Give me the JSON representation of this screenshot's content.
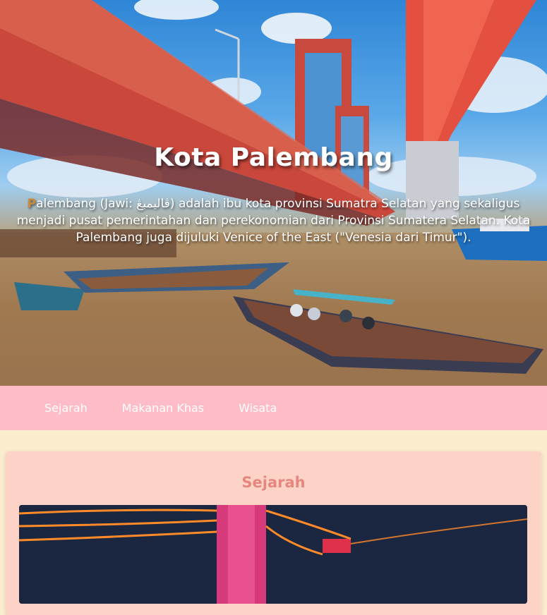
{
  "hero": {
    "title": "Kota Palembang",
    "description_first_letter": "P",
    "description_rest": "alembang (Jawi: ڤاليمبڠ) adalah ibu kota provinsi Sumatra Selatan yang sekaligus menjadi pusat pemerintahan dan perekonomian dari Provinsi Sumatera Selatan. Kota Palembang juga dijuluki Venice of the East (\"Venesia dari Timur\")."
  },
  "nav": {
    "items": [
      {
        "label": "Sejarah"
      },
      {
        "label": "Makanan Khas"
      },
      {
        "label": "Wisata"
      }
    ]
  },
  "main": {
    "section_title": "Sejarah"
  },
  "colors": {
    "nav_bg": "#fdbcc6",
    "page_bg": "#fbeccd",
    "card_bg": "#fdd3c8",
    "section_title": "#e5877c",
    "bridge_red": "#d9473a"
  }
}
